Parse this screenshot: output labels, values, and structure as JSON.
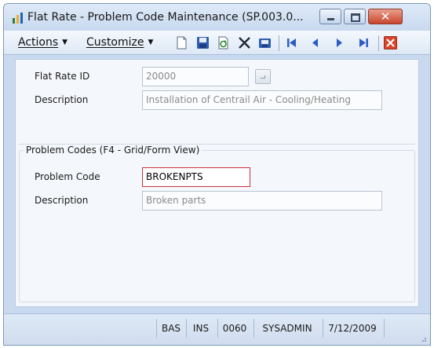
{
  "window": {
    "title": "Flat Rate - Problem Code Maintenance (SP.003.0..."
  },
  "menu": {
    "actions_label": "Actions",
    "customize_label": "Customize"
  },
  "toolbar": {
    "icons": [
      "new-icon",
      "save-icon",
      "refresh-icon",
      "delete-icon",
      "print-icon",
      "first-icon",
      "previous-icon",
      "next-icon",
      "last-icon",
      "close-icon"
    ]
  },
  "header": {
    "flat_rate_id_label": "Flat Rate ID",
    "flat_rate_id_value": "20000",
    "description_label": "Description",
    "description_value": "Installation of Centrail Air - Cooling/Heating"
  },
  "problem_codes": {
    "group_title": "Problem Codes (F4 - Grid/Form View)",
    "problem_code_label": "Problem Code",
    "problem_code_value": "BROKENPTS",
    "description_label": "Description",
    "description_value": "Broken parts"
  },
  "status": {
    "cells": [
      "BAS",
      "INS",
      "0060",
      "SYSADMIN",
      "7/12/2009"
    ]
  },
  "colors": {
    "active_field_border": "#c8323b",
    "window_frame": "#c9daf0"
  }
}
